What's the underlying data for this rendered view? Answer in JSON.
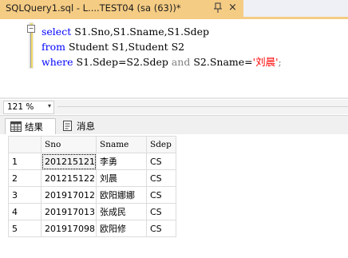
{
  "tab": {
    "title": "SQLQuery1.sql - L....TEST04 (sa (63))*",
    "close_glyph": "×"
  },
  "editor": {
    "lines": [
      {
        "keyword": "select",
        "text": " S1.Sno,S1.Sname,S1.Sdep"
      },
      {
        "keyword": "from",
        "text": " Student S1,Student S2"
      },
      {
        "keyword": "where",
        "text": " S1.Sdep=S2.Sdep ",
        "keyword2": "and",
        "text2": " S2.Sname=",
        "string": "'刘晨'",
        "end": ";"
      }
    ],
    "collapse_glyph": "−"
  },
  "zoom": {
    "value": "121 %",
    "arrow": "▾"
  },
  "results_tabs": [
    {
      "label": "结果",
      "icon": "grid-icon"
    },
    {
      "label": "消息",
      "icon": "message-icon"
    }
  ],
  "grid": {
    "columns": [
      "Sno",
      "Sname",
      "Sdep"
    ],
    "rows": [
      {
        "num": "1",
        "Sno": "201215121",
        "Sname": "李勇",
        "Sdep": "CS"
      },
      {
        "num": "2",
        "Sno": "201215122",
        "Sname": "刘晨",
        "Sdep": "CS"
      },
      {
        "num": "3",
        "Sno": "201917012",
        "Sname": "欧阳娜娜",
        "Sdep": "CS"
      },
      {
        "num": "4",
        "Sno": "201917013",
        "Sname": "张成民",
        "Sdep": "CS"
      },
      {
        "num": "5",
        "Sno": "201917098",
        "Sname": "欧阳修",
        "Sdep": "CS"
      }
    ]
  },
  "colors": {
    "tab_accent": "#f5cc84",
    "keyword": "#0000ff",
    "string": "#ff0000"
  }
}
